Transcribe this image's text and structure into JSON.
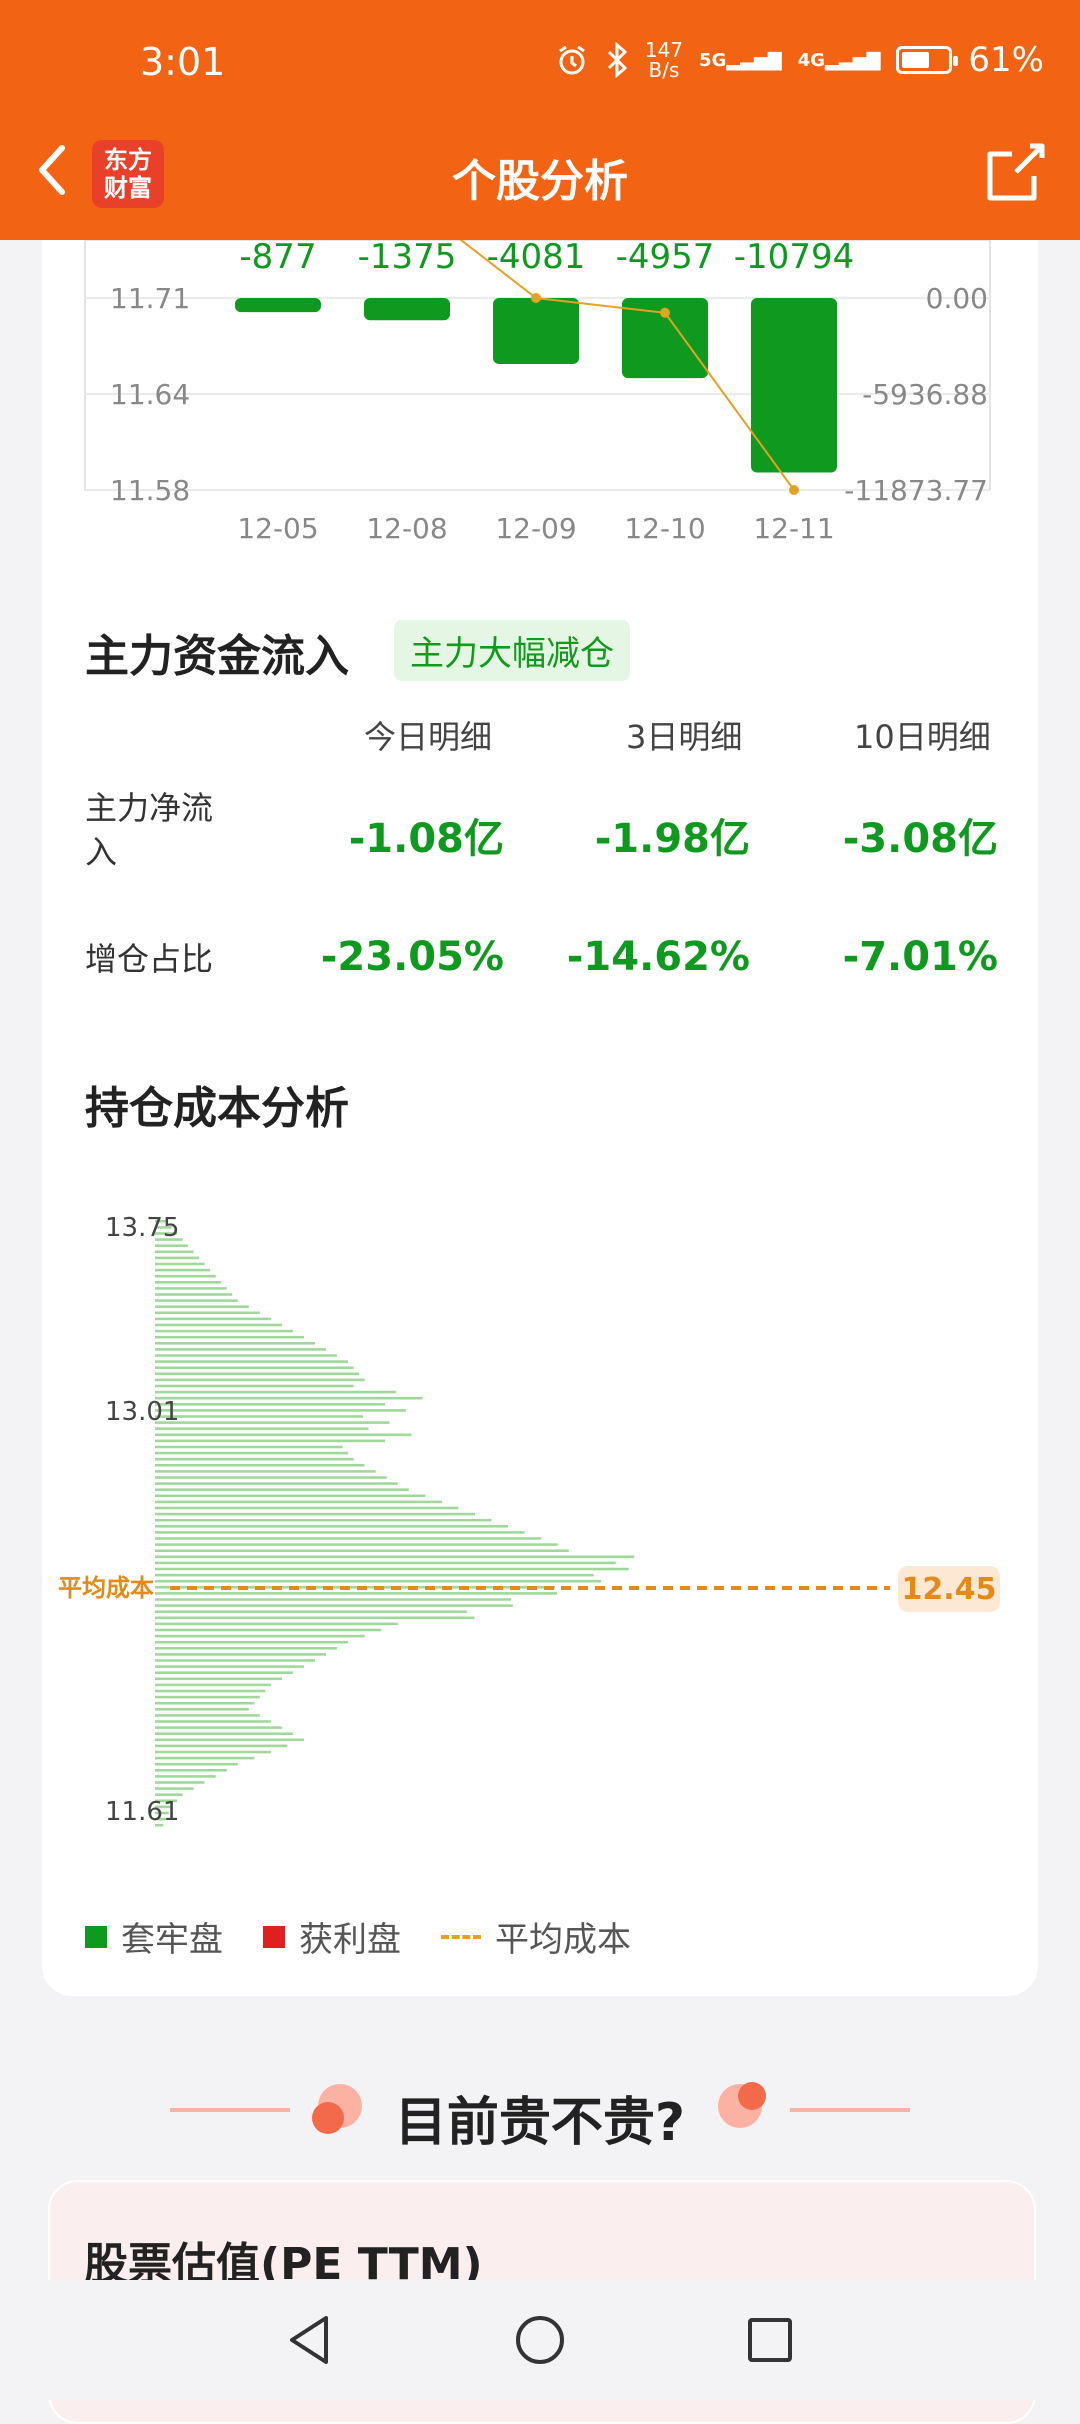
{
  "status": {
    "time": "3:01",
    "net_speed_top": "147",
    "net_speed_bottom": "B/s",
    "sig1": "5G",
    "sig2": "4G",
    "battery": "61%",
    "battery_level": 0.61
  },
  "header": {
    "logo_line1": "东方",
    "logo_line2": "财富",
    "title": "个股分析"
  },
  "colors": {
    "header": "#f26314",
    "down_green": "#0f9a1f",
    "up_red": "#e02020",
    "avg_line": "#e3a21f"
  },
  "flow_chart": {
    "type": "bar",
    "categories": [
      "12-05",
      "12-08",
      "12-09",
      "12-10",
      "12-11"
    ],
    "bar_labels": [
      "-877",
      "-1375",
      "-4081",
      "-4957",
      "-10794"
    ],
    "values": [
      -877,
      -1375,
      -4081,
      -4957,
      -10794
    ],
    "line_values": [
      11.74,
      11.74,
      11.71,
      11.7,
      11.58
    ],
    "left_ticks": [
      "11.71",
      "11.64",
      "11.58"
    ],
    "right_ticks": [
      "0.00",
      "-5936.88",
      "-11873.77"
    ],
    "right_range": [
      -11873.77,
      0
    ]
  },
  "main_flow": {
    "title": "主力资金流入",
    "badge": "主力大幅减仓",
    "columns": [
      "今日明细",
      "3日明细",
      "10日明细"
    ],
    "rows": [
      {
        "label_line1": "主力净流",
        "label_line2": "入",
        "values": [
          "-1.08亿",
          "-1.98亿",
          "-3.08亿"
        ]
      },
      {
        "label_line1": "增仓占比",
        "label_line2": "",
        "values": [
          "-23.05%",
          "-14.62%",
          "-7.01%"
        ]
      }
    ]
  },
  "cost_chart": {
    "title": "持仓成本分析",
    "y_ticks": [
      "13.75",
      "13.01",
      "11.61"
    ],
    "avg_label": "平均成本",
    "avg_value": "12.45"
  },
  "legend": {
    "trapped": "套牢盘",
    "profit": "获利盘",
    "avg": "平均成本"
  },
  "banner": {
    "text": "目前贵不贵?"
  },
  "valuation": {
    "title": "股票估值(PE TTM)"
  }
}
